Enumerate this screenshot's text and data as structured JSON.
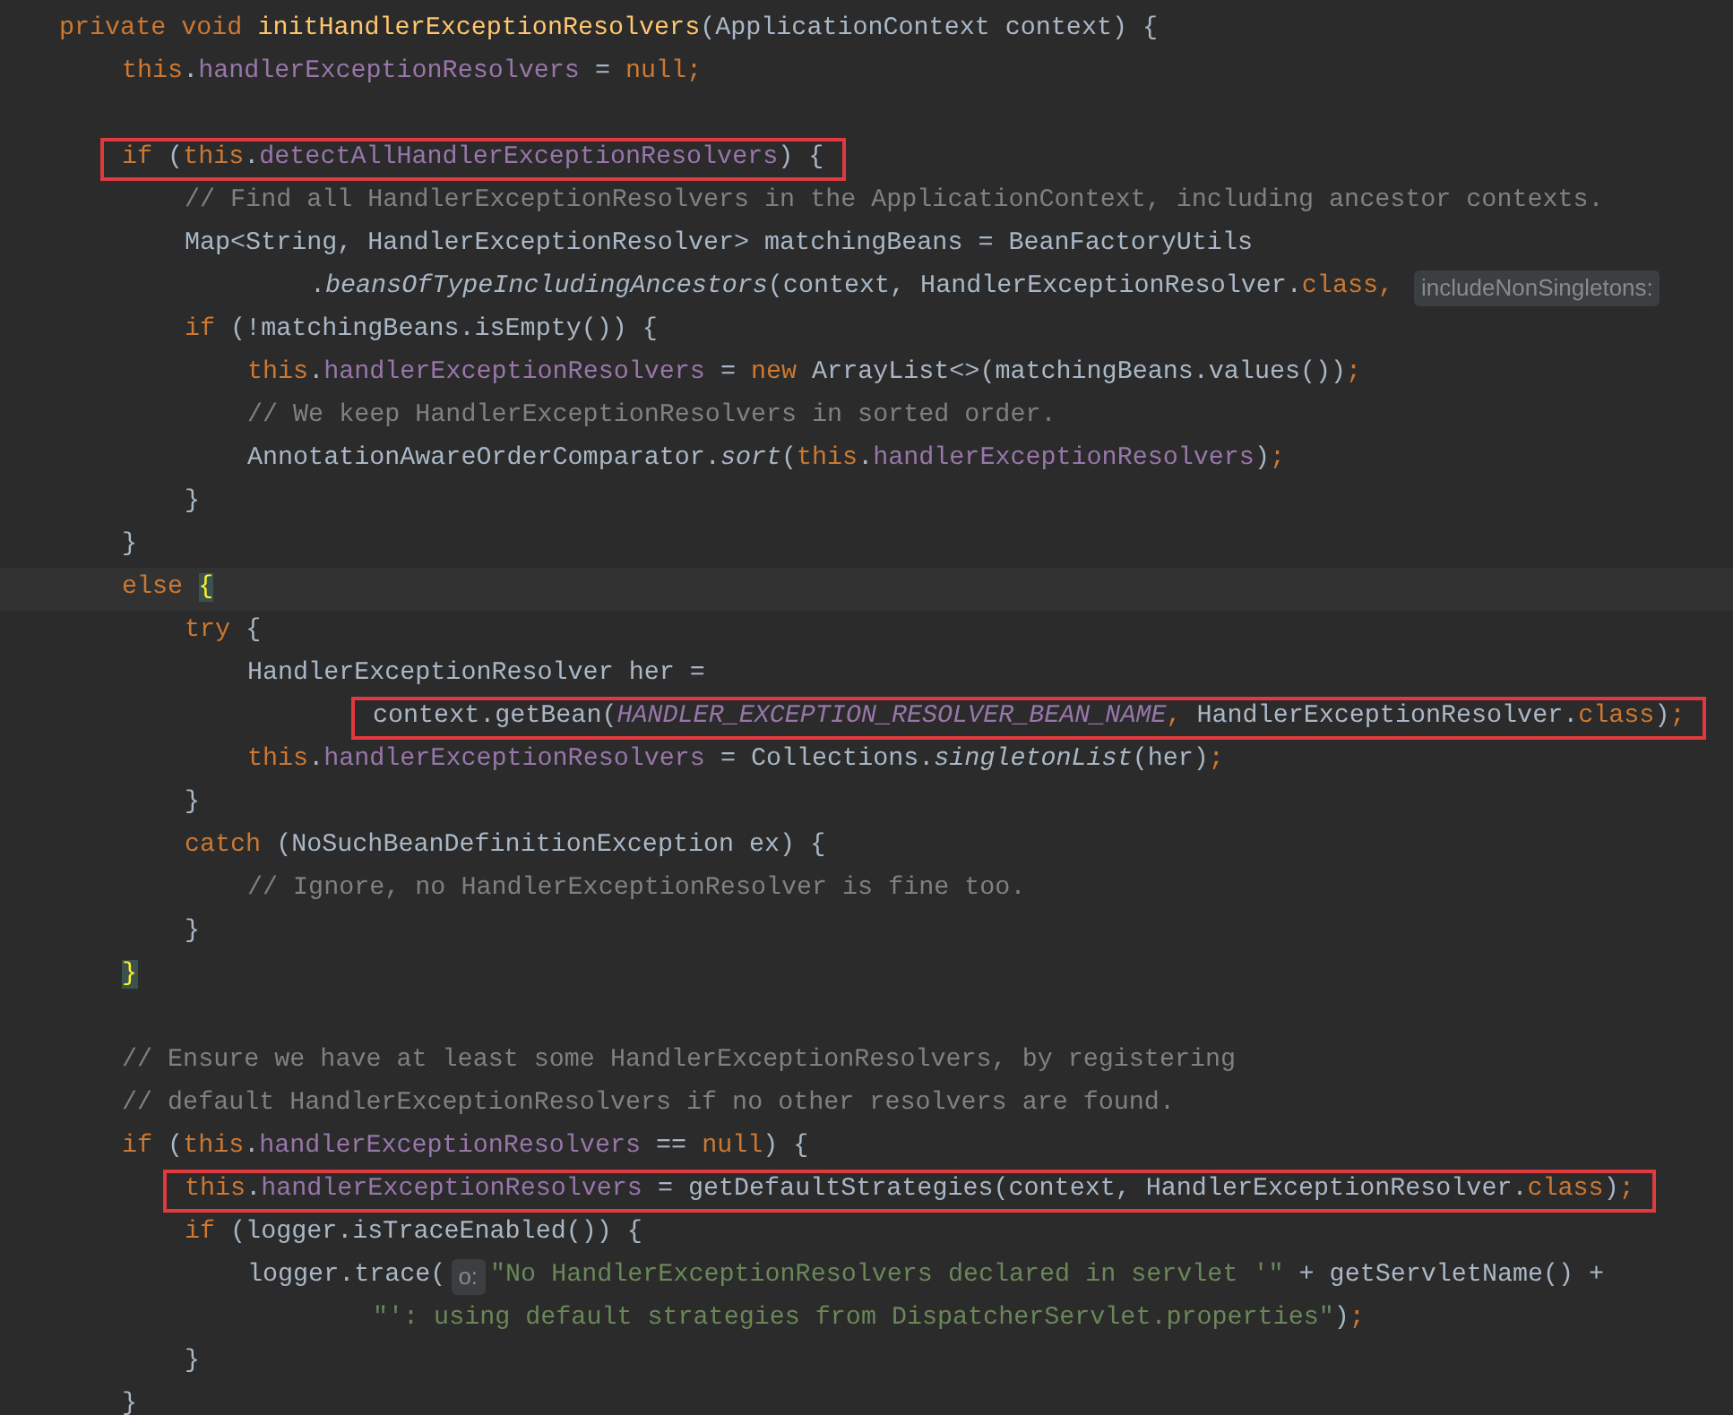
{
  "editor": {
    "lines": [
      {
        "kind": "code",
        "tokens": [
          {
            "text": "private void ",
            "kind": "keyword"
          },
          {
            "text": "initHandlerExceptionResolvers",
            "kind": "method"
          },
          {
            "text": "(ApplicationContext context) {",
            "kind": "plain"
          }
        ],
        "children": [
          {
            "kind": "code",
            "tokens": [
              {
                "text": "this",
                "kind": "keyword"
              },
              {
                "text": ".",
                "kind": "plain"
              },
              {
                "text": "handlerExceptionResolvers",
                "kind": "field"
              },
              {
                "text": " = ",
                "kind": "plain"
              },
              {
                "text": "null",
                "kind": "keyword"
              },
              {
                "text": ";",
                "kind": "keyword"
              }
            ]
          },
          {
            "kind": "blank"
          },
          {
            "kind": "code",
            "boxed": true,
            "tokens": [
              {
                "text": "if ",
                "kind": "keyword"
              },
              {
                "text": "(",
                "kind": "plain"
              },
              {
                "text": "this",
                "kind": "keyword"
              },
              {
                "text": ".",
                "kind": "plain"
              },
              {
                "text": "detectAllHandlerExceptionResolvers",
                "kind": "field"
              },
              {
                "text": ") {",
                "kind": "plain"
              }
            ],
            "children": [
              {
                "kind": "code",
                "tokens": [
                  {
                    "text": "// Find all HandlerExceptionResolvers in the ApplicationContext, including ancestor contexts.",
                    "kind": "comment"
                  }
                ]
              },
              {
                "kind": "code",
                "tokens": [
                  {
                    "text": "Map<String, HandlerExceptionResolver> matchingBeans = BeanFactoryUtils",
                    "kind": "plain"
                  }
                ],
                "continued": [
                  {
                    "kind": "code",
                    "tokens": [
                      {
                        "text": ".",
                        "kind": "plain"
                      },
                      {
                        "text": "beansOfTypeIncludingAncestors",
                        "kind": "static"
                      },
                      {
                        "text": "(context, HandlerExceptionResolver.",
                        "kind": "plain"
                      },
                      {
                        "text": "class, ",
                        "kind": "keyword"
                      },
                      {
                        "text": "includeNonSingletons:",
                        "kind": "hint"
                      }
                    ]
                  }
                ]
              },
              {
                "kind": "code",
                "tokens": [
                  {
                    "text": "if ",
                    "kind": "keyword"
                  },
                  {
                    "text": "(!matchingBeans.isEmpty()) {",
                    "kind": "plain"
                  }
                ],
                "children": [
                  {
                    "kind": "code",
                    "tokens": [
                      {
                        "text": "this",
                        "kind": "keyword"
                      },
                      {
                        "text": ".",
                        "kind": "plain"
                      },
                      {
                        "text": "handlerExceptionResolvers",
                        "kind": "field"
                      },
                      {
                        "text": " = ",
                        "kind": "plain"
                      },
                      {
                        "text": "new ",
                        "kind": "keyword"
                      },
                      {
                        "text": "ArrayList<>(matchingBeans.values())",
                        "kind": "plain"
                      },
                      {
                        "text": ";",
                        "kind": "keyword"
                      }
                    ]
                  },
                  {
                    "kind": "code",
                    "tokens": [
                      {
                        "text": "// We keep HandlerExceptionResolvers in sorted order.",
                        "kind": "comment"
                      }
                    ]
                  },
                  {
                    "kind": "code",
                    "tokens": [
                      {
                        "text": "AnnotationAwareOrderComparator.",
                        "kind": "plain"
                      },
                      {
                        "text": "sort",
                        "kind": "static"
                      },
                      {
                        "text": "(",
                        "kind": "plain"
                      },
                      {
                        "text": "this",
                        "kind": "keyword"
                      },
                      {
                        "text": ".",
                        "kind": "plain"
                      },
                      {
                        "text": "handlerExceptionResolvers",
                        "kind": "field"
                      },
                      {
                        "text": ")",
                        "kind": "plain"
                      },
                      {
                        "text": ";",
                        "kind": "keyword"
                      }
                    ]
                  }
                ]
              },
              {
                "kind": "code",
                "tokens": [
                  {
                    "text": "}",
                    "kind": "plain"
                  }
                ]
              }
            ]
          },
          {
            "kind": "code",
            "tokens": [
              {
                "text": "}",
                "kind": "plain"
              }
            ]
          },
          {
            "kind": "code",
            "current": true,
            "tokens": [
              {
                "text": "else ",
                "kind": "keyword"
              },
              {
                "text": "{",
                "kind": "matched-brace"
              }
            ],
            "children": [
              {
                "kind": "code",
                "tokens": [
                  {
                    "text": "try ",
                    "kind": "keyword"
                  },
                  {
                    "text": "{",
                    "kind": "plain"
                  }
                ],
                "children": [
                  {
                    "kind": "code",
                    "tokens": [
                      {
                        "text": "HandlerExceptionResolver her =",
                        "kind": "plain"
                      }
                    ],
                    "continued": [
                      {
                        "kind": "code",
                        "boxed": true,
                        "tokens": [
                          {
                            "text": "context.getBean(",
                            "kind": "plain"
                          },
                          {
                            "text": "HANDLER_EXCEPTION_RESOLVER_BEAN_NAME",
                            "kind": "constant"
                          },
                          {
                            "text": ", ",
                            "kind": "keyword"
                          },
                          {
                            "text": "HandlerExceptionResolver.",
                            "kind": "plain"
                          },
                          {
                            "text": "class",
                            "kind": "keyword"
                          },
                          {
                            "text": ")",
                            "kind": "plain"
                          },
                          {
                            "text": ";",
                            "kind": "keyword"
                          }
                        ]
                      }
                    ]
                  },
                  {
                    "kind": "code",
                    "tokens": [
                      {
                        "text": "this",
                        "kind": "keyword"
                      },
                      {
                        "text": ".",
                        "kind": "plain"
                      },
                      {
                        "text": "handlerExceptionResolvers",
                        "kind": "field"
                      },
                      {
                        "text": " = Collections.",
                        "kind": "plain"
                      },
                      {
                        "text": "singletonList",
                        "kind": "static"
                      },
                      {
                        "text": "(her)",
                        "kind": "plain"
                      },
                      {
                        "text": ";",
                        "kind": "keyword"
                      }
                    ]
                  }
                ]
              },
              {
                "kind": "code",
                "tokens": [
                  {
                    "text": "}",
                    "kind": "plain"
                  }
                ]
              },
              {
                "kind": "code",
                "tokens": [
                  {
                    "text": "catch ",
                    "kind": "keyword"
                  },
                  {
                    "text": "(NoSuchBeanDefinitionException ex) {",
                    "kind": "plain"
                  }
                ],
                "children": [
                  {
                    "kind": "code",
                    "tokens": [
                      {
                        "text": "// Ignore, no HandlerExceptionResolver is fine too.",
                        "kind": "comment"
                      }
                    ]
                  }
                ]
              },
              {
                "kind": "code",
                "tokens": [
                  {
                    "text": "}",
                    "kind": "plain"
                  }
                ]
              }
            ]
          },
          {
            "kind": "code",
            "tokens": [
              {
                "text": "}",
                "kind": "matched-brace"
              }
            ]
          },
          {
            "kind": "blank"
          },
          {
            "kind": "code",
            "tokens": [
              {
                "text": "// Ensure we have at least some HandlerExceptionResolvers, by registering",
                "kind": "comment"
              }
            ]
          },
          {
            "kind": "code",
            "tokens": [
              {
                "text": "// default HandlerExceptionResolvers if no other resolvers are found.",
                "kind": "comment"
              }
            ]
          },
          {
            "kind": "code",
            "tokens": [
              {
                "text": "if ",
                "kind": "keyword"
              },
              {
                "text": "(",
                "kind": "plain"
              },
              {
                "text": "this",
                "kind": "keyword"
              },
              {
                "text": ".",
                "kind": "plain"
              },
              {
                "text": "handlerExceptionResolvers",
                "kind": "field"
              },
              {
                "text": " == ",
                "kind": "plain"
              },
              {
                "text": "null",
                "kind": "keyword"
              },
              {
                "text": ") {",
                "kind": "plain"
              }
            ],
            "children": [
              {
                "kind": "code",
                "boxed": true,
                "tokens": [
                  {
                    "text": "this",
                    "kind": "keyword"
                  },
                  {
                    "text": ".",
                    "kind": "plain"
                  },
                  {
                    "text": "handlerExceptionResolvers",
                    "kind": "field"
                  },
                  {
                    "text": " = getDefaultStrategies(context, HandlerExceptionResolver.",
                    "kind": "plain"
                  },
                  {
                    "text": "class",
                    "kind": "keyword"
                  },
                  {
                    "text": ")",
                    "kind": "plain"
                  },
                  {
                    "text": ";",
                    "kind": "keyword"
                  }
                ]
              },
              {
                "kind": "code",
                "tokens": [
                  {
                    "text": "if ",
                    "kind": "keyword"
                  },
                  {
                    "text": "(logger.isTraceEnabled()) {",
                    "kind": "plain"
                  }
                ],
                "children": [
                  {
                    "kind": "code",
                    "tokens": [
                      {
                        "text": "logger.trace(",
                        "kind": "plain"
                      },
                      {
                        "text": "o:",
                        "kind": "hint"
                      },
                      {
                        "text": "\"No HandlerExceptionResolvers declared in servlet '\"",
                        "kind": "string"
                      },
                      {
                        "text": " + getServletName() +",
                        "kind": "plain"
                      }
                    ],
                    "continued": [
                      {
                        "kind": "code",
                        "tokens": [
                          {
                            "text": "\"': using default strategies from DispatcherServlet.properties\"",
                            "kind": "string"
                          },
                          {
                            "text": ")",
                            "kind": "plain"
                          },
                          {
                            "text": ";",
                            "kind": "keyword"
                          }
                        ]
                      }
                    ]
                  }
                ]
              },
              {
                "kind": "code",
                "tokens": [
                  {
                    "text": "}",
                    "kind": "plain"
                  }
                ]
              }
            ]
          },
          {
            "kind": "code",
            "tokens": [
              {
                "text": "}",
                "kind": "plain"
              }
            ]
          }
        ]
      }
    ]
  }
}
